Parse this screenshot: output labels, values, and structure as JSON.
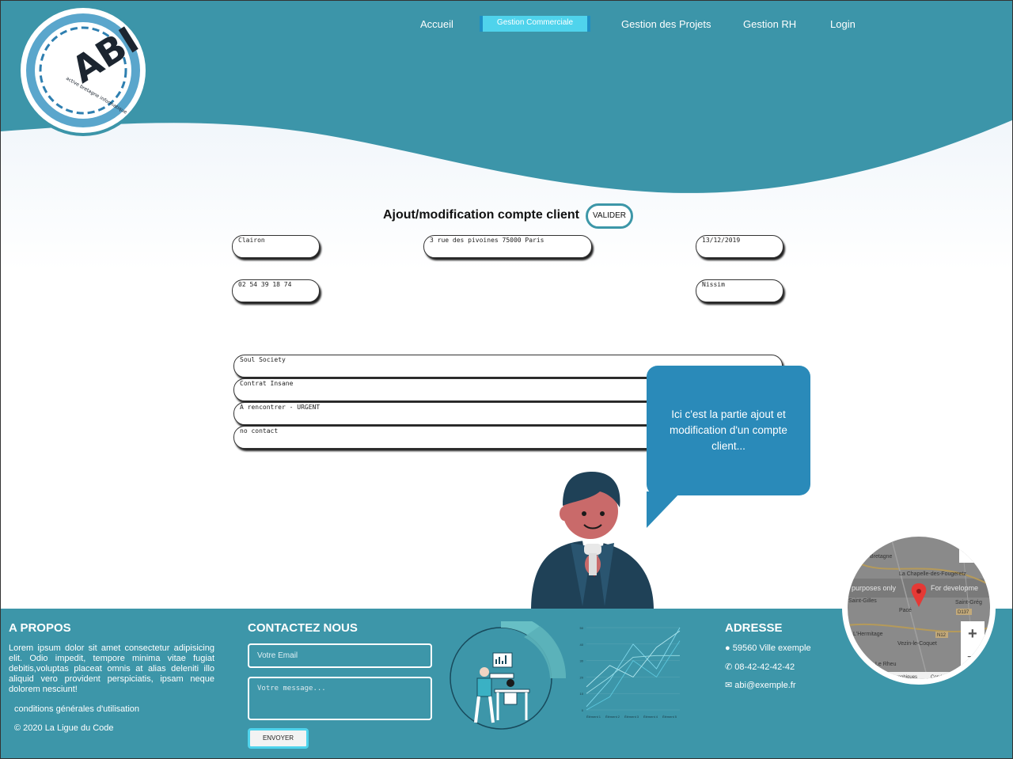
{
  "nav": {
    "items": [
      "Accueil",
      "Gestion des Projets",
      "Gestion RH",
      "Login"
    ],
    "active": "Gestion Commerciale"
  },
  "logo": {
    "text": "ABI",
    "tagline": "active bretagne informatique"
  },
  "form": {
    "title": "Ajout/modification compte client",
    "submit": "VALIDER",
    "fields": {
      "name": "Clairon",
      "address": "3 rue des pivoines 75000 Paris",
      "date": "13/12/2019",
      "phone": "02 54 39 18 74",
      "contact": "Nissim",
      "company": "Soul Society",
      "contract": "Contrat Insane",
      "status": "A rencontrer - URGENT",
      "notes": "no contact"
    }
  },
  "bubble": {
    "text": "Ici c'est la partie ajout et modification d'un compte client..."
  },
  "footer": {
    "about": {
      "title": "A PROPOS",
      "text": "Lorem ipsum dolor sit amet consectetur adipisicing elit. Odio impedit, tempore minima vitae fugiat debitis,voluptas placeat omnis at alias deleniti illo aliquid vero provident perspiciatis, ipsam neque dolorem nesciunt!",
      "terms": "conditions générales d'utilisation",
      "copyright": "© 2020 La Ligue du Code"
    },
    "contact": {
      "title": "CONTACTEZ NOUS",
      "email_placeholder": "Votre Email",
      "message_placeholder": "Votre message...",
      "send": "ENVOYER"
    },
    "address": {
      "title": "ADRESSE",
      "city": "59560 Ville exemple",
      "phone": "08-42-42-42-42",
      "email": "abi@exemple.fr"
    }
  },
  "chart_data": {
    "type": "line",
    "categories": [
      "Élément 1",
      "Élément 2",
      "Élément 3",
      "Élément 4",
      "Élément 5"
    ],
    "yticks": [
      0,
      10,
      20,
      30,
      40,
      50
    ],
    "ylim": [
      0,
      50
    ],
    "series": [
      {
        "values": [
          2,
          18,
          40,
          25,
          50
        ]
      },
      {
        "values": [
          10,
          20,
          32,
          33,
          33
        ]
      },
      {
        "values": [
          0,
          8,
          30,
          20,
          42
        ]
      },
      {
        "values": [
          14,
          27,
          20,
          38,
          48
        ]
      }
    ]
  },
  "map": {
    "labels": [
      "Bretagne",
      "La Chapelle-des-Fougeretz",
      "purposes only",
      "For developme",
      "Saint-Gilles",
      "Pacé",
      "Saint-Grég",
      "L'Hermitage",
      "Vezin-le-Coquet",
      "Le Rheu",
      "ographiques",
      "Cond"
    ],
    "roads": [
      "D137",
      "N12"
    ],
    "zoom_in": "+",
    "zoom_out": "−"
  },
  "colors": {
    "primary": "#3d96a9",
    "bubble": "#2a8ab9",
    "accent": "#4fd3ec"
  }
}
